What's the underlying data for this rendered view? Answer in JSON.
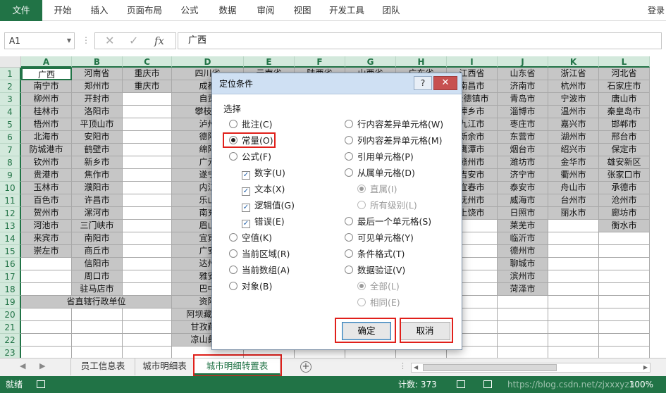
{
  "ribbon": {
    "tabs": [
      "文件",
      "开始",
      "插入",
      "页面布局",
      "公式",
      "数据",
      "审阅",
      "视图",
      "开发工具",
      "团队"
    ],
    "login": "登录"
  },
  "formula_bar": {
    "name_box": "A1",
    "cancel_glyph": "✕",
    "enter_glyph": "✓",
    "fx_glyph": "fx",
    "value": "广西"
  },
  "columns": [
    "A",
    "B",
    "C",
    "D",
    "E",
    "F",
    "G",
    "H",
    "I",
    "J",
    "K",
    "L"
  ],
  "rows": [
    "1",
    "2",
    "3",
    "4",
    "5",
    "6",
    "7",
    "8",
    "9",
    "10",
    "11",
    "12",
    "13",
    "14",
    "15",
    "16",
    "17",
    "18",
    "19",
    "20",
    "21",
    "22",
    "23"
  ],
  "grid": {
    "A": [
      "广西",
      "南宁市",
      "柳州市",
      "桂林市",
      "梧州市",
      "北海市",
      "防城港市",
      "钦州市",
      "贵港市",
      "玉林市",
      "百色市",
      "贺州市",
      "河池市",
      "来宾市",
      "崇左市",
      "",
      "",
      "",
      "",
      "",
      "",
      "",
      ""
    ],
    "B": [
      "河南省",
      "郑州市",
      "开封市",
      "洛阳市",
      "平顶山市",
      "安阳市",
      "鹤壁市",
      "新乡市",
      "焦作市",
      "濮阳市",
      "许昌市",
      "漯河市",
      "三门峡市",
      "南阳市",
      "商丘市",
      "信阳市",
      "周口市",
      "驻马店市",
      "",
      "",
      "",
      "",
      ""
    ],
    "C": [
      "重庆市",
      "重庆市",
      "",
      "",
      "",
      "",
      "",
      "",
      "",
      "",
      "",
      "",
      "",
      "",
      "",
      "",
      "",
      "",
      "",
      "",
      "",
      "",
      ""
    ],
    "D": [
      "四川省",
      "成都",
      "自贡",
      "攀枝花",
      "泸州",
      "德阳",
      "绵阳",
      "广元",
      "遂宁",
      "内江",
      "乐山",
      "南充",
      "眉山",
      "宜宾",
      "广安",
      "达州",
      "雅安",
      "巴中",
      "资阳",
      "阿坝藏族羌",
      "甘孜藏族",
      "凉山彝族",
      "",
      ""
    ],
    "E": [
      "云南省",
      "",
      "",
      "",
      "",
      "",
      "",
      "",
      "",
      "",
      "",
      "",
      "",
      "",
      "",
      "",
      "",
      "",
      "",
      "",
      "",
      "",
      ""
    ],
    "F": [
      "陕西省",
      "",
      "",
      "",
      "",
      "",
      "",
      "",
      "",
      "",
      "",
      "",
      "",
      "",
      "",
      "",
      "",
      "",
      "",
      "",
      "",
      "",
      ""
    ],
    "G": [
      "山西省",
      "",
      "",
      "",
      "",
      "",
      "",
      "",
      "",
      "",
      "",
      "",
      "",
      "",
      "",
      "",
      "",
      "",
      "",
      "",
      "",
      "",
      ""
    ],
    "H": [
      "广东省",
      "",
      "",
      "",
      "",
      "",
      "",
      "",
      "",
      "",
      "",
      "",
      "",
      "",
      "",
      "",
      "",
      "",
      "",
      "",
      "",
      "",
      ""
    ],
    "I": [
      "江西省",
      "南昌市",
      "景德镇市",
      "萍乡市",
      "九江市",
      "新余市",
      "鹰潭市",
      "赣州市",
      "吉安市",
      "宜春市",
      "抚州市",
      "上饶市",
      "",
      "",
      "",
      "",
      "",
      "",
      "",
      "",
      "",
      "",
      ""
    ],
    "J": [
      "山东省",
      "济南市",
      "青岛市",
      "淄博市",
      "枣庄市",
      "东营市",
      "烟台市",
      "潍坊市",
      "济宁市",
      "泰安市",
      "威海市",
      "日照市",
      "莱芜市",
      "临沂市",
      "德州市",
      "聊城市",
      "滨州市",
      "菏泽市",
      "",
      "",
      "",
      "",
      ""
    ],
    "K": [
      "浙江省",
      "杭州市",
      "宁波市",
      "温州市",
      "嘉兴市",
      "湖州市",
      "绍兴市",
      "金华市",
      "衢州市",
      "舟山市",
      "台州市",
      "丽水市",
      "",
      "",
      "",
      "",
      "",
      "",
      "",
      "",
      "",
      "",
      ""
    ],
    "L": [
      "河北省",
      "石家庄市",
      "唐山市",
      "秦皇岛市",
      "邯郸市",
      "邢台市",
      "保定市",
      "雄安新区",
      "张家口市",
      "承德市",
      "沧州市",
      "廊坊市",
      "衡水市",
      "",
      "",
      "",
      "",
      "",
      "",
      "",
      "",
      "",
      ""
    ]
  },
  "merged_label": "省直辖行政单位",
  "dialog": {
    "title": "定位条件",
    "help": "?",
    "close": "✕",
    "section": "选择",
    "left_options": [
      {
        "label": "批注(C)",
        "kind": "radio",
        "checked": false,
        "disabled": false
      },
      {
        "label": "常量(O)",
        "kind": "radio",
        "checked": true,
        "disabled": false
      },
      {
        "label": "公式(F)",
        "kind": "radio",
        "checked": false,
        "disabled": false
      },
      {
        "label": "数字(U)",
        "kind": "check",
        "checked": true,
        "disabled": false
      },
      {
        "label": "文本(X)",
        "kind": "check",
        "checked": true,
        "disabled": false
      },
      {
        "label": "逻辑值(G)",
        "kind": "check",
        "checked": true,
        "disabled": false
      },
      {
        "label": "错误(E)",
        "kind": "check",
        "checked": true,
        "disabled": false
      },
      {
        "label": "空值(K)",
        "kind": "radio",
        "checked": false,
        "disabled": false
      },
      {
        "label": "当前区域(R)",
        "kind": "radio",
        "checked": false,
        "disabled": false
      },
      {
        "label": "当前数组(A)",
        "kind": "radio",
        "checked": false,
        "disabled": false
      },
      {
        "label": "对象(B)",
        "kind": "radio",
        "checked": false,
        "disabled": false
      }
    ],
    "right_options": [
      {
        "label": "行内容差异单元格(W)",
        "kind": "radio",
        "checked": false,
        "disabled": false
      },
      {
        "label": "列内容差异单元格(M)",
        "kind": "radio",
        "checked": false,
        "disabled": false
      },
      {
        "label": "引用单元格(P)",
        "kind": "radio",
        "checked": false,
        "disabled": false
      },
      {
        "label": "从属单元格(D)",
        "kind": "radio",
        "checked": false,
        "disabled": false
      },
      {
        "label": "直属(I)",
        "kind": "radio",
        "checked": true,
        "disabled": true
      },
      {
        "label": "所有级别(L)",
        "kind": "radio",
        "checked": false,
        "disabled": true
      },
      {
        "label": "最后一个单元格(S)",
        "kind": "radio",
        "checked": false,
        "disabled": false
      },
      {
        "label": "可见单元格(Y)",
        "kind": "radio",
        "checked": false,
        "disabled": false
      },
      {
        "label": "条件格式(T)",
        "kind": "radio",
        "checked": false,
        "disabled": false
      },
      {
        "label": "数据验证(V)",
        "kind": "radio",
        "checked": false,
        "disabled": false
      },
      {
        "label": "全部(L)",
        "kind": "radio",
        "checked": true,
        "disabled": true
      },
      {
        "label": "相同(E)",
        "kind": "radio",
        "checked": false,
        "disabled": true
      }
    ],
    "ok": "确定",
    "cancel": "取消"
  },
  "sheets": {
    "tabs": [
      "员工信息表",
      "城市明细表",
      "城市明细转置表"
    ],
    "active": "城市明细转置表",
    "add": "+"
  },
  "status": {
    "ready": "就绪",
    "count": "计数: 373",
    "zoom": "100%",
    "watermark": "https://blog.csdn.net/zjxxxyz3"
  },
  "colors": {
    "accent": "#217346",
    "highlight": "#e0201b",
    "selection": "#c6c6c6"
  }
}
